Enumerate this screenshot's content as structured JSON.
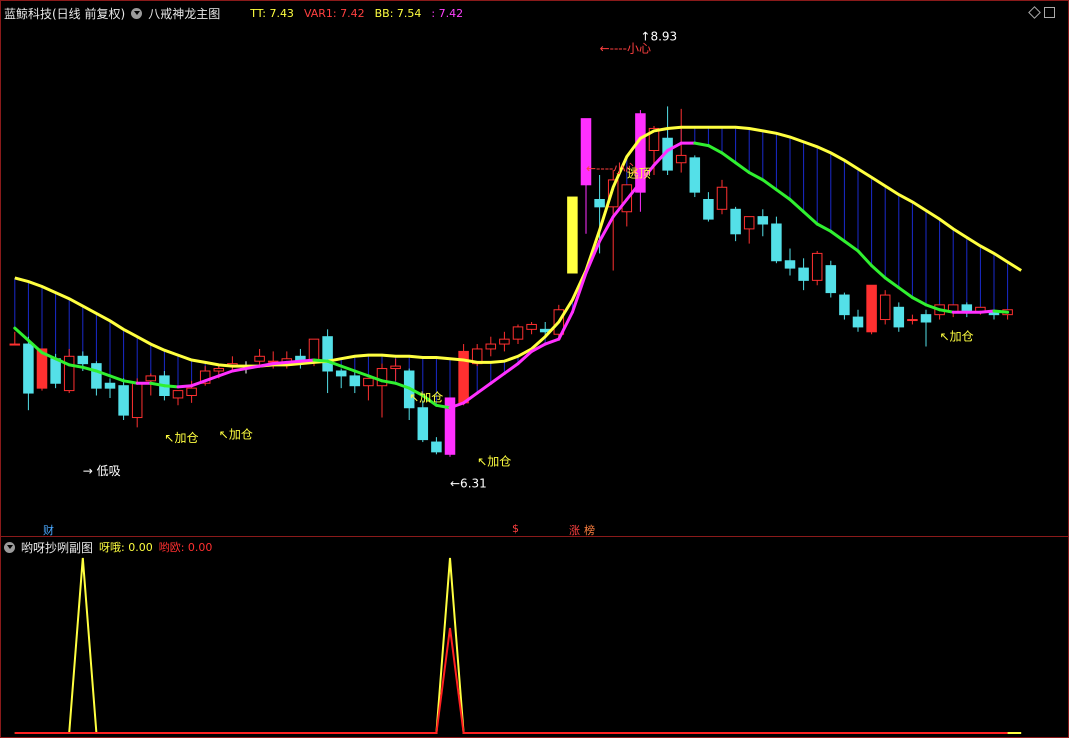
{
  "header": {
    "title": "蓝鲸科技(日线 前复权)",
    "indicator_name": "八戒神龙主图",
    "values": [
      {
        "label": "TT: 7.43",
        "color": "#ffff40"
      },
      {
        "label": "VAR1: 7.42",
        "color": "#ff4040"
      },
      {
        "label": "BB: 7.54",
        "color": "#ffff40"
      },
      {
        "label": ": 7.42",
        "color": "#ff40ff"
      }
    ]
  },
  "sub_header": {
    "name": "哟呀抄咧副图",
    "values": [
      {
        "label": "呀哦: 0.00",
        "color": "#ffff40"
      },
      {
        "label": "哟欧: 0.00",
        "color": "#ff3030"
      }
    ]
  },
  "markers": [
    {
      "text": "财",
      "color": "#4aa8ff"
    },
    {
      "text": "$",
      "color": "#ff4040"
    },
    {
      "text": "涨",
      "color": "#ff4040"
    },
    {
      "text": "榜",
      "color": "#ff8040"
    }
  ],
  "colors": {
    "up": "#ff3030",
    "down": "#54e0e8",
    "yellow": "#ffff40",
    "green": "#30f030",
    "magenta": "#ff30ff",
    "blue": "#1a2acc",
    "white": "#ffffff"
  },
  "chart_data": [
    {
      "type": "candlestick",
      "ylim": [
        5.6,
        9.6
      ],
      "candles": [
        {
          "o": 7.02,
          "h": 7.12,
          "c": 7.02,
          "l": 7.02
        },
        {
          "o": 7.02,
          "h": 7.08,
          "c": 6.62,
          "l": 6.48
        },
        {
          "o": 6.66,
          "h": 6.98,
          "c": 6.98,
          "l": 6.64,
          "style": "fill"
        },
        {
          "o": 6.9,
          "h": 6.94,
          "c": 6.7,
          "l": 6.66
        },
        {
          "o": 6.64,
          "h": 6.98,
          "c": 6.92,
          "l": 6.62
        },
        {
          "o": 6.92,
          "h": 6.96,
          "c": 6.86,
          "l": 6.8
        },
        {
          "o": 6.86,
          "h": 6.88,
          "c": 6.66,
          "l": 6.6
        },
        {
          "o": 6.7,
          "h": 6.74,
          "c": 6.66,
          "l": 6.58
        },
        {
          "o": 6.68,
          "h": 6.74,
          "c": 6.44,
          "l": 6.4
        },
        {
          "o": 6.42,
          "h": 6.74,
          "c": 6.7,
          "l": 6.34
        },
        {
          "o": 6.72,
          "h": 6.78,
          "c": 6.76,
          "l": 6.6
        },
        {
          "o": 6.76,
          "h": 6.8,
          "c": 6.6,
          "l": 6.56
        },
        {
          "o": 6.58,
          "h": 6.64,
          "c": 6.64,
          "l": 6.52
        },
        {
          "o": 6.6,
          "h": 6.72,
          "c": 6.66,
          "l": 6.54
        },
        {
          "o": 6.7,
          "h": 6.84,
          "c": 6.8,
          "l": 6.68
        },
        {
          "o": 6.8,
          "h": 6.86,
          "c": 6.82,
          "l": 6.74
        },
        {
          "o": 6.84,
          "h": 6.92,
          "c": 6.86,
          "l": 6.8
        },
        {
          "o": 6.86,
          "h": 6.88,
          "c": 6.84,
          "l": 6.78,
          "style": "cross"
        },
        {
          "o": 6.88,
          "h": 6.98,
          "c": 6.92,
          "l": 6.84
        },
        {
          "o": 6.88,
          "h": 6.96,
          "c": 6.88,
          "l": 6.82
        },
        {
          "o": 6.86,
          "h": 6.96,
          "c": 6.9,
          "l": 6.82
        },
        {
          "o": 6.92,
          "h": 6.98,
          "c": 6.86,
          "l": 6.82
        },
        {
          "o": 6.88,
          "h": 7.06,
          "c": 7.06,
          "l": 6.84
        },
        {
          "o": 7.08,
          "h": 7.14,
          "c": 6.8,
          "l": 6.62
        },
        {
          "o": 6.8,
          "h": 6.82,
          "c": 6.76,
          "l": 6.66
        },
        {
          "o": 6.76,
          "h": 6.8,
          "c": 6.68,
          "l": 6.62
        },
        {
          "o": 6.68,
          "h": 6.74,
          "c": 6.74,
          "l": 6.56
        },
        {
          "o": 6.68,
          "h": 6.86,
          "c": 6.82,
          "l": 6.42
        },
        {
          "o": 6.82,
          "h": 6.9,
          "c": 6.84,
          "l": 6.72
        },
        {
          "o": 6.8,
          "h": 6.82,
          "c": 6.5,
          "l": 6.4
        },
        {
          "o": 6.5,
          "h": 6.56,
          "c": 6.24,
          "l": 6.22
        },
        {
          "o": 6.22,
          "h": 6.26,
          "c": 6.14,
          "l": 6.12
        },
        {
          "o": 6.12,
          "h": 6.58,
          "c": 6.58,
          "l": 6.1,
          "style": "fill",
          "color": "#ff30ff"
        },
        {
          "o": 6.54,
          "h": 7.02,
          "c": 6.96,
          "l": 6.52,
          "style": "fill"
        },
        {
          "o": 6.86,
          "h": 7.02,
          "c": 6.98,
          "l": 6.84
        },
        {
          "o": 6.98,
          "h": 7.08,
          "c": 7.02,
          "l": 6.92
        },
        {
          "o": 7.02,
          "h": 7.12,
          "c": 7.06,
          "l": 6.96
        },
        {
          "o": 7.06,
          "h": 7.18,
          "c": 7.16,
          "l": 7.02
        },
        {
          "o": 7.14,
          "h": 7.2,
          "c": 7.18,
          "l": 7.1
        },
        {
          "o": 7.14,
          "h": 7.2,
          "c": 7.12,
          "l": 7.08
        },
        {
          "o": 7.1,
          "h": 7.34,
          "c": 7.3,
          "l": 7.06
        },
        {
          "o": 7.6,
          "h": 7.84,
          "c": 8.22,
          "l": 7.6,
          "style": "fill",
          "color": "#ffff40"
        },
        {
          "o": 8.32,
          "h": 8.84,
          "c": 8.86,
          "l": 7.92,
          "style": "fill",
          "color": "#ff30ff"
        },
        {
          "o": 8.2,
          "h": 8.4,
          "c": 8.14,
          "l": 7.76
        },
        {
          "o": 8.14,
          "h": 8.44,
          "c": 8.36,
          "l": 7.62
        },
        {
          "o": 8.1,
          "h": 8.26,
          "c": 8.32,
          "l": 7.98
        },
        {
          "o": 8.26,
          "h": 8.93,
          "c": 8.9,
          "l": 8.1,
          "style": "fill",
          "color": "#ff30ff"
        },
        {
          "o": 8.6,
          "h": 8.8,
          "c": 8.78,
          "l": 8.4
        },
        {
          "o": 8.7,
          "h": 8.96,
          "c": 8.44,
          "l": 8.4
        },
        {
          "o": 8.5,
          "h": 8.94,
          "c": 8.56,
          "l": 8.42
        },
        {
          "o": 8.54,
          "h": 8.56,
          "c": 8.26,
          "l": 8.22
        },
        {
          "o": 8.2,
          "h": 8.26,
          "c": 8.04,
          "l": 8.02
        },
        {
          "o": 8.12,
          "h": 8.36,
          "c": 8.3,
          "l": 8.08
        },
        {
          "o": 8.12,
          "h": 8.14,
          "c": 7.92,
          "l": 7.86
        },
        {
          "o": 7.96,
          "h": 8.06,
          "c": 8.06,
          "l": 7.84
        },
        {
          "o": 8.06,
          "h": 8.12,
          "c": 8.0,
          "l": 7.9
        },
        {
          "o": 8.0,
          "h": 8.06,
          "c": 7.7,
          "l": 7.68
        },
        {
          "o": 7.7,
          "h": 7.8,
          "c": 7.64,
          "l": 7.58
        },
        {
          "o": 7.64,
          "h": 7.72,
          "c": 7.54,
          "l": 7.46
        },
        {
          "o": 7.54,
          "h": 7.78,
          "c": 7.76,
          "l": 7.5
        },
        {
          "o": 7.66,
          "h": 7.7,
          "c": 7.44,
          "l": 7.4
        },
        {
          "o": 7.42,
          "h": 7.44,
          "c": 7.26,
          "l": 7.22
        },
        {
          "o": 7.24,
          "h": 7.3,
          "c": 7.16,
          "l": 7.12
        },
        {
          "o": 7.12,
          "h": 7.5,
          "c": 7.5,
          "l": 7.1,
          "style": "fill"
        },
        {
          "o": 7.22,
          "h": 7.46,
          "c": 7.42,
          "l": 7.18
        },
        {
          "o": 7.32,
          "h": 7.36,
          "c": 7.16,
          "l": 7.12
        },
        {
          "o": 7.22,
          "h": 7.26,
          "c": 7.22,
          "l": 7.18
        },
        {
          "o": 7.26,
          "h": 7.3,
          "c": 7.2,
          "l": 7.0
        },
        {
          "o": 7.26,
          "h": 7.34,
          "c": 7.34,
          "l": 7.22
        },
        {
          "o": 7.28,
          "h": 7.34,
          "c": 7.34,
          "l": 7.24
        },
        {
          "o": 7.34,
          "h": 7.36,
          "c": 7.28,
          "l": 7.24
        },
        {
          "o": 7.28,
          "h": 7.3,
          "c": 7.32,
          "l": 7.26
        },
        {
          "o": 7.28,
          "h": 7.3,
          "c": 7.26,
          "l": 7.22
        },
        {
          "o": 7.26,
          "h": 7.3,
          "c": 7.3,
          "l": 7.22
        }
      ],
      "yellow_line": [
        7.56,
        7.53,
        7.49,
        7.44,
        7.39,
        7.33,
        7.27,
        7.21,
        7.14,
        7.08,
        7.02,
        6.97,
        6.93,
        6.89,
        6.87,
        6.85,
        6.84,
        6.84,
        6.84,
        6.85,
        6.85,
        6.86,
        6.87,
        6.88,
        6.9,
        6.92,
        6.93,
        6.93,
        6.92,
        6.92,
        6.91,
        6.91,
        6.9,
        6.89,
        6.87,
        6.87,
        6.88,
        6.92,
        6.98,
        7.08,
        7.2,
        7.38,
        7.62,
        7.95,
        8.3,
        8.55,
        8.7,
        8.76,
        8.78,
        8.79,
        8.79,
        8.79,
        8.79,
        8.79,
        8.78,
        8.76,
        8.74,
        8.71,
        8.67,
        8.63,
        8.58,
        8.52,
        8.45,
        8.38,
        8.31,
        8.24,
        8.18,
        8.11,
        8.04,
        7.96,
        7.89,
        7.82,
        7.76,
        7.69,
        7.62
      ],
      "lower_line": [
        7.15,
        7.05,
        6.95,
        6.9,
        6.85,
        6.83,
        6.8,
        6.76,
        6.72,
        6.7,
        6.7,
        6.68,
        6.67,
        6.68,
        6.72,
        6.76,
        6.8,
        6.82,
        6.84,
        6.86,
        6.87,
        6.88,
        6.89,
        6.88,
        6.84,
        6.8,
        6.76,
        6.72,
        6.7,
        6.66,
        6.6,
        6.52,
        6.5,
        6.54,
        6.62,
        6.7,
        6.78,
        6.86,
        6.96,
        7.02,
        7.06,
        7.28,
        7.6,
        7.86,
        8.06,
        8.2,
        8.34,
        8.48,
        8.6,
        8.66,
        8.66,
        8.64,
        8.58,
        8.5,
        8.42,
        8.36,
        8.28,
        8.2,
        8.1,
        8.0,
        7.94,
        7.86,
        7.78,
        7.66,
        7.56,
        7.48,
        7.4,
        7.34,
        7.3,
        7.28,
        7.28,
        7.28,
        7.29,
        7.28,
        7.28
      ],
      "annotations": [
        {
          "text": "→ 低吸",
          "color": "#ffffff",
          "x": 5,
          "y": 5.95
        },
        {
          "text": "↖加仓",
          "color": "#ffff40",
          "x": 11,
          "y": 6.22
        },
        {
          "text": "↖加仓",
          "color": "#ffff40",
          "x": 15,
          "y": 6.25
        },
        {
          "text": "↖加仓",
          "color": "#ffff40",
          "x": 29,
          "y": 6.55
        },
        {
          "text": "↖加仓",
          "color": "#ffff40",
          "x": 34,
          "y": 6.03
        },
        {
          "text": "↖加仓",
          "color": "#ffff40",
          "x": 68,
          "y": 7.05
        },
        {
          "text": "←6.31",
          "color": "#ffffff",
          "x": 32,
          "y": 5.85
        },
        {
          "text": "←----小心",
          "color": "#ff4040",
          "x": 43,
          "y": 9.4
        },
        {
          "text": "↑8.93",
          "color": "#ffffff",
          "x": 46,
          "y": 9.5
        },
        {
          "text": "←----小心",
          "color": "#ff4040",
          "x": 42,
          "y": 8.42
        },
        {
          "text": "逃顶",
          "color": "#ffff40",
          "x": 45,
          "y": 8.38
        }
      ]
    },
    {
      "type": "line",
      "ylim": [
        0,
        1
      ],
      "series": [
        {
          "values": [
            0,
            0,
            0,
            0,
            0,
            1,
            0,
            0,
            0,
            0,
            0,
            0,
            0,
            0,
            0,
            0,
            0,
            0,
            0,
            0,
            0,
            0,
            0,
            0,
            0,
            0,
            0,
            0,
            0,
            0,
            0,
            0,
            1,
            0,
            0,
            0,
            0,
            0,
            0,
            0,
            0,
            0,
            0,
            0,
            0,
            0,
            0,
            0,
            0,
            0,
            0,
            0,
            0,
            0,
            0,
            0,
            0,
            0,
            0,
            0,
            0,
            0,
            0,
            0,
            0,
            0,
            0,
            0,
            0,
            0,
            0,
            0,
            0,
            0,
            0
          ],
          "color": "#ffff40"
        },
        {
          "values": [
            0,
            0,
            0,
            0,
            0,
            0,
            0,
            0,
            0,
            0,
            0,
            0,
            0,
            0,
            0,
            0,
            0,
            0,
            0,
            0,
            0,
            0,
            0,
            0,
            0,
            0,
            0,
            0,
            0,
            0,
            0,
            0,
            0.6,
            0,
            0,
            0,
            0,
            0,
            0,
            0,
            0,
            0,
            0,
            0,
            0,
            0,
            0,
            0,
            0,
            0,
            0,
            0,
            0,
            0,
            0,
            0,
            0,
            0,
            0,
            0,
            0,
            0,
            0,
            0,
            0,
            0,
            0,
            0,
            0,
            0,
            0,
            0,
            0,
            0
          ],
          "color": "#ff2020"
        }
      ]
    }
  ]
}
